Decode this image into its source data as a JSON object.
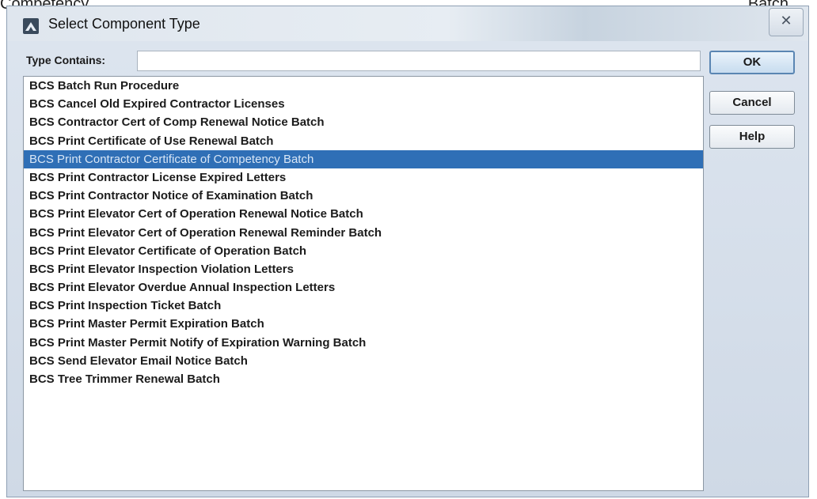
{
  "background": {
    "left_text": "Competency",
    "right_text": "Batch"
  },
  "dialog": {
    "title": "Select Component Type",
    "close_symbol": "✕",
    "filter": {
      "label": "Type Contains:",
      "value": "",
      "placeholder": ""
    },
    "buttons": {
      "ok": "OK",
      "cancel": "Cancel",
      "help": "Help"
    },
    "selected_index": 4,
    "items": [
      "BCS Batch Run Procedure",
      "BCS Cancel Old Expired Contractor Licenses",
      "BCS Contractor Cert of Comp Renewal Notice Batch",
      "BCS Print Certificate of Use Renewal Batch",
      "BCS Print Contractor Certificate of Competency Batch",
      "BCS Print Contractor License Expired Letters",
      "BCS Print Contractor Notice of Examination Batch",
      "BCS Print Elevator Cert of Operation Renewal Notice Batch",
      "BCS Print Elevator Cert of Operation Renewal Reminder Batch",
      "BCS Print Elevator Certificate of Operation Batch",
      "BCS Print Elevator Inspection Violation Letters",
      "BCS Print Elevator Overdue Annual Inspection Letters",
      "BCS Print Inspection Ticket Batch",
      "BCS Print Master Permit Expiration Batch",
      "BCS Print Master Permit Notify of Expiration Warning Batch",
      "BCS Send Elevator Email Notice Batch",
      "BCS Tree Trimmer Renewal Batch"
    ],
    "colors": {
      "selection": "#2f6fb6",
      "selection_text": "#d8e6f6"
    }
  }
}
